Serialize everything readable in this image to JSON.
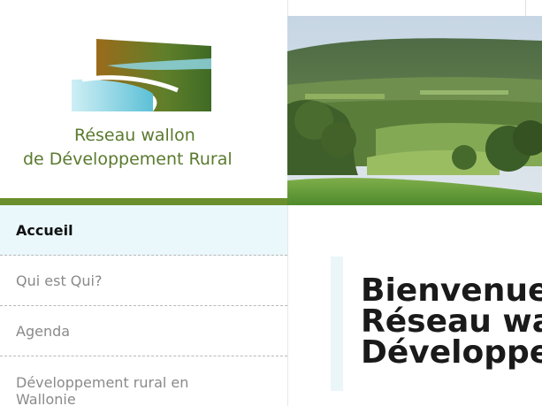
{
  "brand": {
    "line1": "Réseau wallon",
    "line2": "de Développement Rural",
    "colors": {
      "brown": "#8b6a1e",
      "green": "#4f7a2a",
      "teal": "#7ad0de",
      "text": "#5a7a2e"
    }
  },
  "hero": {
    "icon": "landscape-photo"
  },
  "nav": {
    "items": [
      {
        "label": "Accueil"
      },
      {
        "label": "Qui est Qui?"
      },
      {
        "label": "Agenda"
      },
      {
        "label": "Développement rural en Wallonie"
      }
    ]
  },
  "main": {
    "welcome_lines": [
      "Bienvenue",
      "Réseau wa",
      "Développe"
    ]
  }
}
